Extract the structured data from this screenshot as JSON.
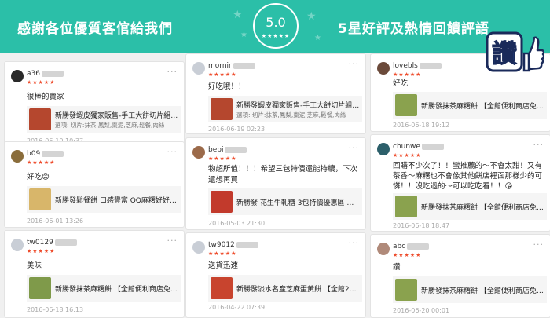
{
  "banner": {
    "left_text": "感謝各位優質客倌給我們",
    "score": "5.0",
    "score_stars": "★★★★★",
    "right_text": "5星好評及熱情回饋評語",
    "sticker_text": "讚",
    "bg_color": "#2bbfa8"
  },
  "stars": "★★★★★",
  "more": "···",
  "reviews": [
    {
      "user": "a36",
      "comment": "很棒的賣家",
      "product_title": "新勝發蝦皮獨家販售-手工大餅切片組合-...",
      "variation": "選項: 切片:抹茶,鳳梨,棗泥,芝麻,鬆餐,肉絲",
      "date": "2016-06-10 10:37"
    },
    {
      "user": "b09",
      "comment": "好吃😊",
      "product_title": "新勝發鬆餐餅 口感豐富 QQ麻糬好好吃 ...",
      "variation": "",
      "date": "2016-06-01 13:26"
    },
    {
      "user": "tw0129",
      "comment": "美味",
      "product_title": "新勝發抹茶麻糬餅 【全館便利商店免運...",
      "variation": "",
      "date": "2016-06-18 16:13"
    },
    {
      "user": "mornir",
      "comment": "好吃哦！！",
      "product_title": "新勝發蝦皮獨家販售-手工大餅切片組合-...",
      "variation": "選項: 切片:抹茶,鳳梨,棗泥,芝麻,鬆餐,肉絲",
      "date": "2016-06-19 02:23"
    },
    {
      "user": "bebi",
      "comment": "物超所值！！！希望三包特價還能持續，下次還想再買",
      "product_title": "新勝發 花生牛軋糖 3包特價優惠區 團購...",
      "variation": "",
      "date": "2016-05-03 21:30"
    },
    {
      "user": "tw9012",
      "comment": "送貨迅速",
      "product_title": "新勝發淡水名產芝麻蛋黃餅 【全館200...",
      "variation": "",
      "date": "2016-04-22 07:39"
    },
    {
      "user": "lovebls",
      "comment": "好吃",
      "product_title": "新勝發抹茶麻糬餅 【全館便利商店免運...",
      "variation": "",
      "date": "2016-06-18 19:12"
    },
    {
      "user": "chunwe",
      "comment": "回購不少次了！！蠻推薦的～不會太甜！又有茶香～麻糬也不會像其他餅店裡面那樣少的可憐！！沒吃過的～可以吃吃看！！😘",
      "product_title": "新勝發抹茶麻糬餅 【全館便利商店免運...",
      "variation": "",
      "date": "2016-06-18 18:47"
    },
    {
      "user": "abc",
      "comment": "讚",
      "product_title": "新勝發抹茶麻糬餅 【全館便利商店免運...",
      "variation": "",
      "date": "2016-06-20 00:01"
    }
  ]
}
